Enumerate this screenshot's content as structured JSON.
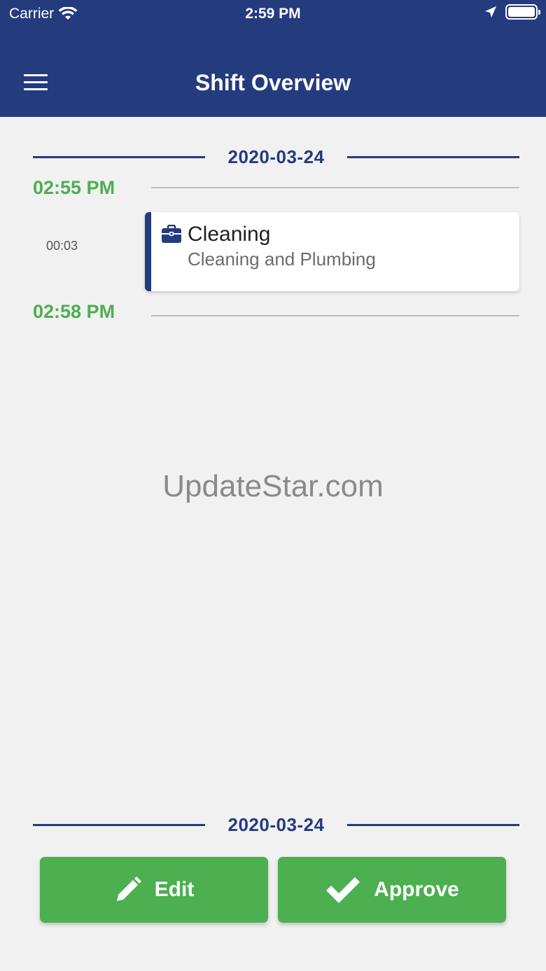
{
  "status_bar": {
    "carrier": "Carrier",
    "time": "2:59 PM"
  },
  "header": {
    "title": "Shift Overview",
    "menu_icon": "hamburger-menu-icon"
  },
  "timeline": {
    "top_date": "2020-03-24",
    "start_time": "02:55 PM",
    "end_time": "02:58 PM",
    "duration": "00:03",
    "shift": {
      "icon": "briefcase-icon",
      "title": "Cleaning",
      "subtitle": "Cleaning and Plumbing"
    },
    "bottom_date": "2020-03-24"
  },
  "watermark": "UpdateStar.com",
  "actions": {
    "edit_label": "Edit",
    "edit_icon": "pencil-icon",
    "approve_label": "Approve",
    "approve_icon": "checkmark-icon"
  },
  "colors": {
    "primary": "#243b7e",
    "accent_green": "#4caf50",
    "background": "#f1f1f2"
  }
}
